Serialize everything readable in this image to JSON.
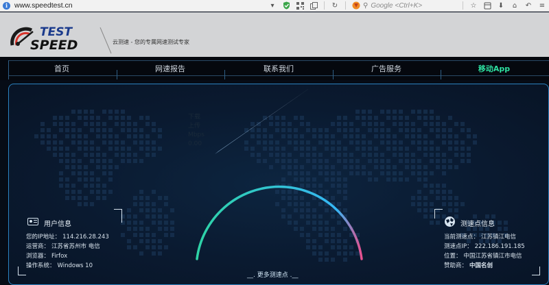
{
  "browser": {
    "url": "www.speedtest.cn",
    "search_placeholder": "Google <Ctrl+K>",
    "info_icon": "i"
  },
  "site": {
    "logo_text_top": "TEST",
    "logo_text_bottom": "SPEED",
    "tagline": "云测速 - 您的专属网速测试专家"
  },
  "nav": {
    "items": [
      {
        "label": "首页"
      },
      {
        "label": "网速报告"
      },
      {
        "label": "联系我们"
      },
      {
        "label": "广告服务"
      },
      {
        "label": "移动App"
      }
    ]
  },
  "gauge": {
    "readout": [
      "下载",
      "上传",
      "Mbps",
      "0.00"
    ],
    "more_nodes": "__. 更多测速点 .__",
    "accent_start": "#2ed3a6",
    "accent_end": "#35b6f5",
    "accent_tail": "#e8508f"
  },
  "user_info": {
    "title": "用户信息",
    "rows": [
      {
        "label": "您的IP地址：",
        "value": "114.216.28.243"
      },
      {
        "label": "运营商：",
        "value": "江苏省苏州市 电信"
      },
      {
        "label": "浏览器：",
        "value": "Firfox"
      },
      {
        "label": "操作系统：",
        "value": "Windows 10"
      }
    ]
  },
  "node_info": {
    "title": "测速点信息",
    "rows": [
      {
        "label": "当前测速点：",
        "value": "江苏镇江电信"
      },
      {
        "label": "测速点IP：",
        "value": "222.186.191.185"
      },
      {
        "label": "位置：",
        "value": "中国江苏省镇江市电信"
      },
      {
        "label": "赞助商：",
        "value": "中国名创"
      }
    ]
  }
}
